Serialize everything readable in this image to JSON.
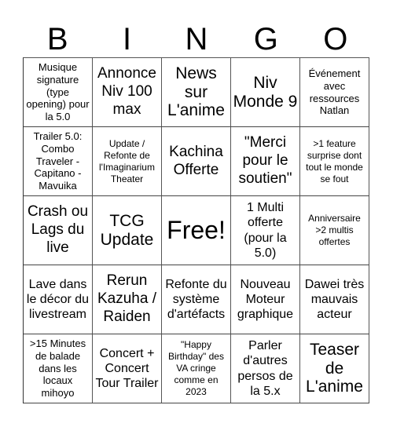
{
  "header": {
    "letters": [
      "B",
      "I",
      "N",
      "G",
      "O"
    ]
  },
  "cells": [
    [
      "Musique signature (type opening) pour la 5.0",
      "Annonce Niv 100 max",
      "News sur L'anime",
      "Niv Monde 9",
      "Événement avec ressources Natlan"
    ],
    [
      "Trailer 5.0: Combo Traveler - Capitano - Mavuika",
      "Update / Refonte de l'Imaginarium Theater",
      "Kachina Offerte",
      "\"Merci pour le soutien\"",
      ">1 feature surprise dont tout le monde se fout"
    ],
    [
      "Crash ou Lags du live",
      "TCG Update",
      "Free!",
      "1 Multi offerte (pour la 5.0)",
      "Anniversaire >2 multis offertes"
    ],
    [
      "Lave dans le décor du livestream",
      "Rerun Kazuha / Raiden",
      "Refonte du système d'artéfacts",
      "Nouveau Moteur graphique",
      "Dawei très mauvais acteur"
    ],
    [
      ">15 Minutes de balade dans les locaux mihoyo",
      "Concert + Concert Tour Trailer",
      "\"Happy Birthday\" des VA cringe comme en 2023",
      "Parler d'autres persos de la 5.x",
      "Teaser de L'anime"
    ]
  ],
  "free_cell": {
    "row": 2,
    "col": 2
  }
}
